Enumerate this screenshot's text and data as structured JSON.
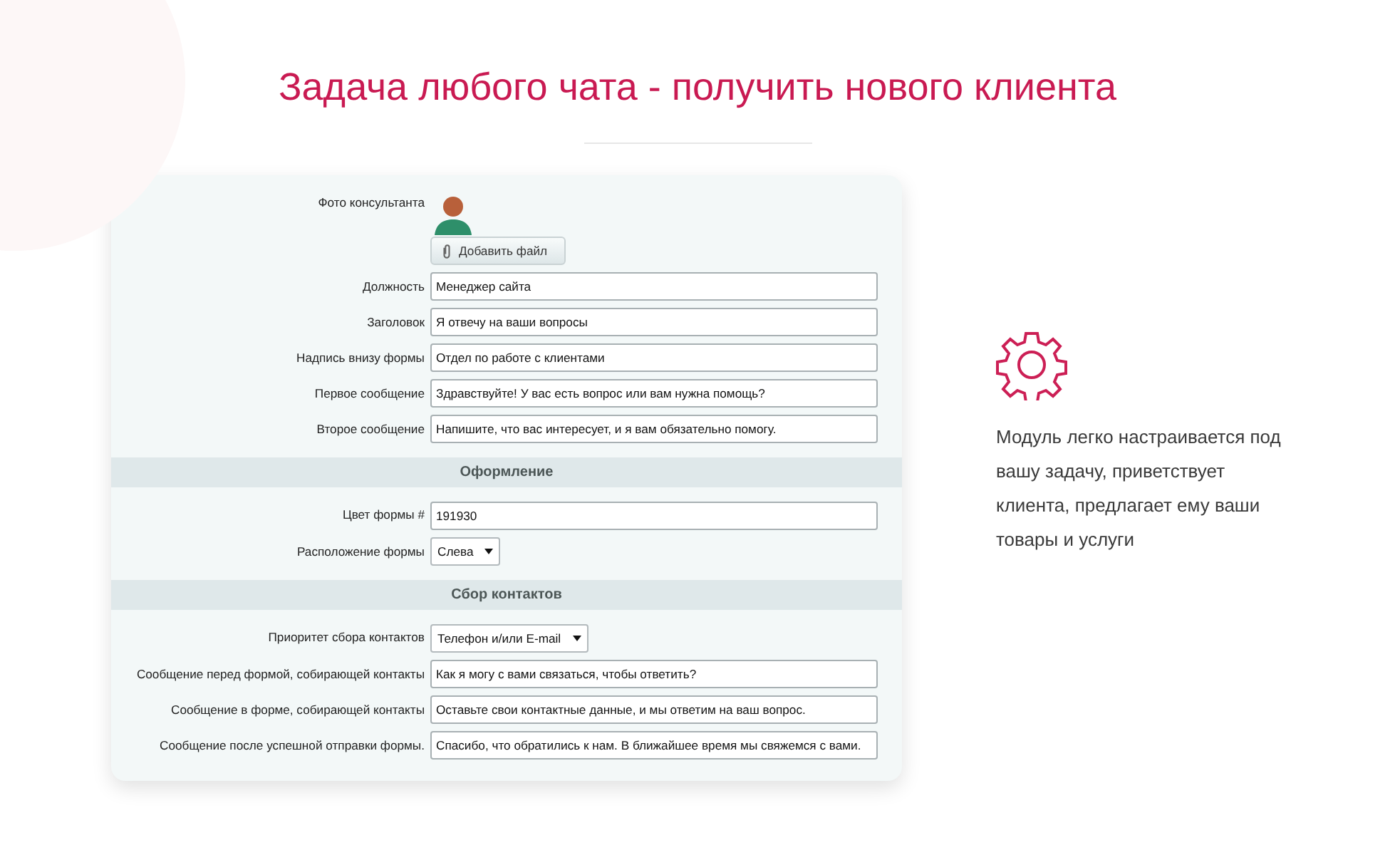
{
  "heading": "Задача любого чата - получить нового клиента",
  "form": {
    "sections": [
      {
        "fields": [
          {
            "kind": "photo",
            "label": "Фото консультанта",
            "button": "Добавить файл"
          },
          {
            "kind": "text",
            "label": "Должность",
            "value": "Менеджер сайта"
          },
          {
            "kind": "text",
            "label": "Заголовок",
            "value": "Я отвечу на ваши вопросы"
          },
          {
            "kind": "text",
            "label": "Надпись внизу формы",
            "value": "Отдел по работе с клиентами"
          },
          {
            "kind": "text",
            "label": "Первое сообщение",
            "value": "Здравствуйте! У вас есть вопрос или вам нужна помощь?"
          },
          {
            "kind": "text",
            "label": "Второе сообщение",
            "value": "Напишите, что вас интересует, и я вам обязательно помогу."
          }
        ]
      },
      {
        "title": "Оформление",
        "fields": [
          {
            "kind": "text",
            "label": "Цвет формы #",
            "value": "191930"
          },
          {
            "kind": "select",
            "label": "Расположение формы",
            "value": "Слева"
          }
        ]
      },
      {
        "title": "Сбор контактов",
        "fields": [
          {
            "kind": "select",
            "label": "Приоритет сбора контактов",
            "value": "Телефон и/или E-mail"
          },
          {
            "kind": "text",
            "label": "Сообщение перед формой, собирающей контакты",
            "value": "Как я могу с вами связаться, чтобы ответить?"
          },
          {
            "kind": "text",
            "label": "Сообщение в форме, собирающей контакты",
            "value": "Оставьте свои контактные данные, и мы ответим на ваш вопрос."
          },
          {
            "kind": "text",
            "label": "Сообщение после успешной отправки формы.",
            "value": "Спасибо, что обратились к нам. В ближайшее время мы свяжемся с вами."
          }
        ]
      }
    ]
  },
  "feature": {
    "text": "Модуль легко настраивается под вашу задачу, приветствует клиента, предлагает ему ваши товары и услуги"
  }
}
